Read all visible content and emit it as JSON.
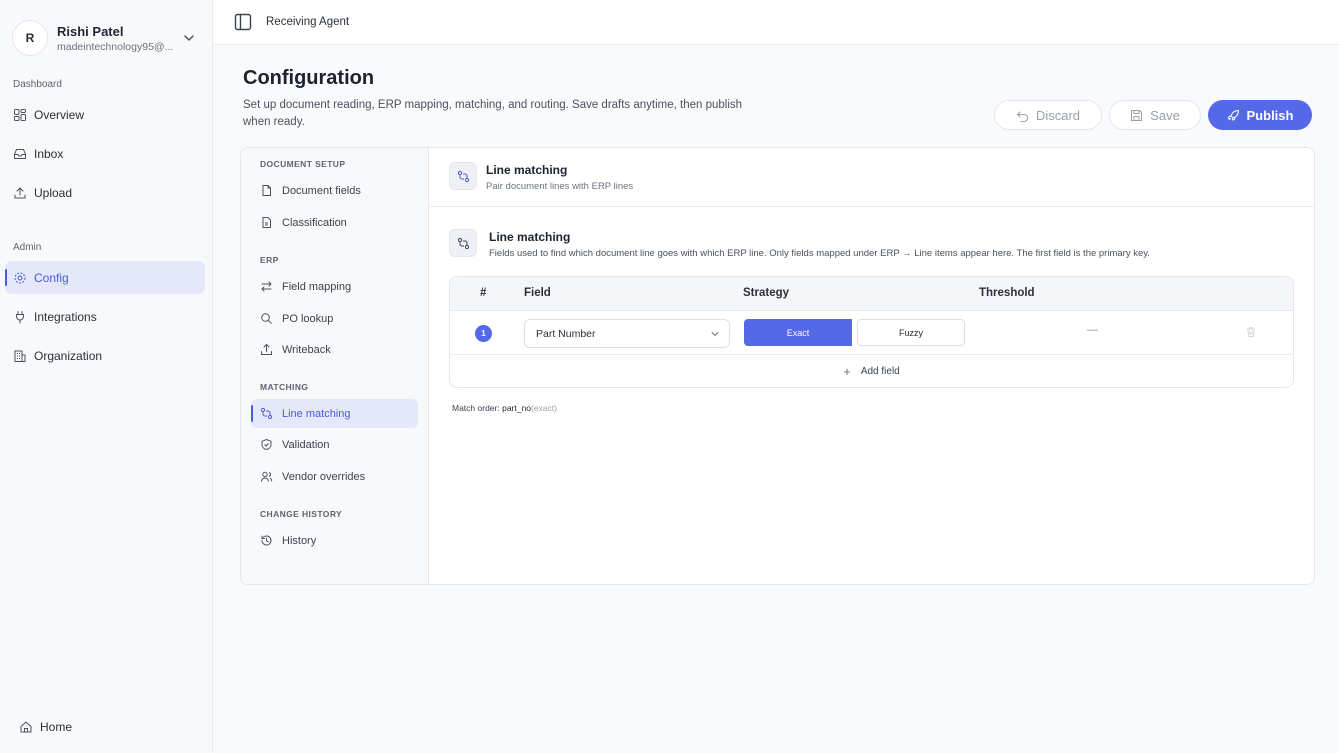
{
  "user": {
    "initial": "R",
    "name": "Rishi Patel",
    "email": "madeintechnology95@..."
  },
  "sidebar": {
    "dashboard_label": "Dashboard",
    "dashboard_items": [
      {
        "label": "Overview",
        "icon": "grid-icon"
      },
      {
        "label": "Inbox",
        "icon": "inbox-icon"
      },
      {
        "label": "Upload",
        "icon": "upload-icon"
      }
    ],
    "admin_label": "Admin",
    "admin_items": [
      {
        "label": "Config",
        "icon": "gear-icon",
        "active": true
      },
      {
        "label": "Integrations",
        "icon": "plug-icon"
      },
      {
        "label": "Organization",
        "icon": "building-icon"
      }
    ],
    "home_label": "Home"
  },
  "header": {
    "title": "Receiving Agent"
  },
  "page": {
    "title": "Configuration",
    "description": "Set up document reading, ERP mapping, matching, and routing. Save drafts anytime, then publish when ready."
  },
  "actions": {
    "discard": "Discard",
    "save": "Save",
    "publish": "Publish"
  },
  "subnav": {
    "document_setup_label": "DOCUMENT SETUP",
    "document_setup": [
      "Document fields",
      "Classification"
    ],
    "erp_label": "ERP",
    "erp": [
      "Field mapping",
      "PO lookup",
      "Writeback"
    ],
    "matching_label": "MATCHING",
    "matching": [
      "Line matching",
      "Validation",
      "Vendor overrides"
    ],
    "history_label": "CHANGE HISTORY",
    "history": [
      "History"
    ]
  },
  "content": {
    "title": "Line matching",
    "subtitle": "Pair document lines with ERP lines",
    "section_title": "Line matching",
    "section_desc": "Fields used to find which document line goes with which ERP line. Only fields mapped under ERP → Line items appear here. The first field is the primary key.",
    "table": {
      "headers": [
        "#",
        "Field",
        "Strategy",
        "Threshold"
      ],
      "rows": [
        {
          "index": "1",
          "field": "Part Number",
          "strategy_exact": "Exact",
          "strategy_fuzzy": "Fuzzy",
          "selected_strategy": "Exact",
          "threshold": "—"
        }
      ],
      "add_label": "Add field"
    },
    "match_order_label": "Match order:",
    "match_order_key": "part_no",
    "match_order_mode": "(exact)"
  },
  "colors": {
    "accent": "#5468e8",
    "active_bg": "#e5e8fb"
  }
}
